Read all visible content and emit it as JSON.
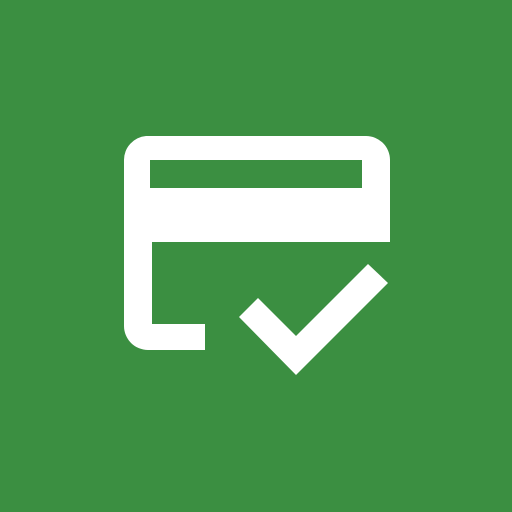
{
  "icon": {
    "name": "credit-card-check-icon",
    "background_color": "#3b8f41",
    "glyph_color": "#ffffff"
  }
}
